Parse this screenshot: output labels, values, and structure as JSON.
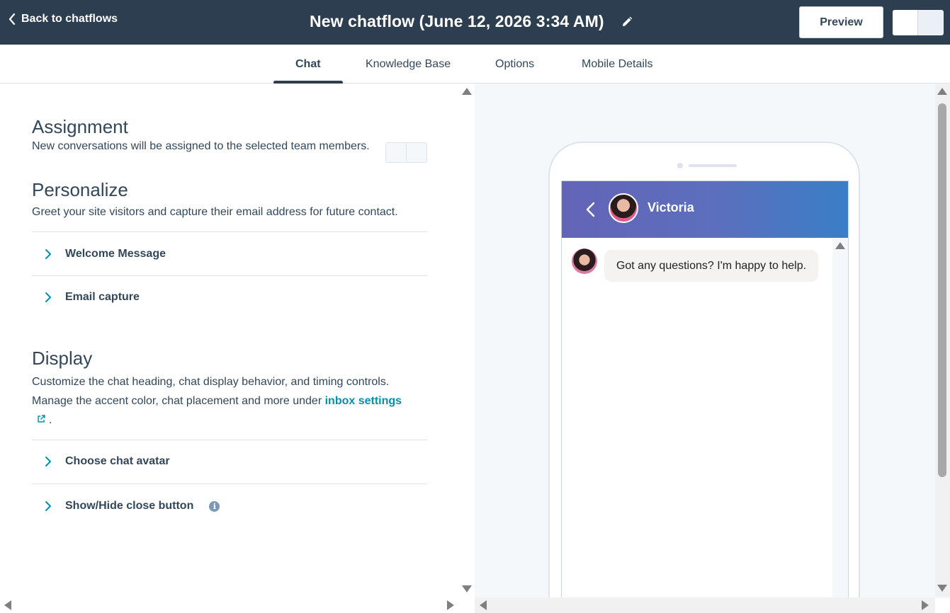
{
  "header": {
    "back_label": "Back to chatflows",
    "title": "New chatflow (June 12, 2026 3:34 AM)",
    "preview_label": "Preview"
  },
  "tabs": [
    {
      "label": "Chat",
      "active": true
    },
    {
      "label": "Knowledge Base",
      "active": false
    },
    {
      "label": "Options",
      "active": false
    },
    {
      "label": "Mobile Details",
      "active": false
    }
  ],
  "assignment": {
    "title": "Assignment",
    "description": "New conversations will be assigned to the selected team members."
  },
  "personalize": {
    "title": "Personalize",
    "description": "Greet your site visitors and capture their email address for future contact.",
    "items": [
      "Welcome Message",
      "Email capture"
    ]
  },
  "display": {
    "title": "Display",
    "description_1": "Customize the chat heading, chat display behavior, and timing controls.",
    "description_2": "Manage the accent color, chat placement and more under",
    "link_label": "inbox settings",
    "description_end": ".",
    "items": [
      "Choose chat avatar",
      "Show/Hide close button"
    ]
  },
  "preview": {
    "agent_name": "Victoria",
    "message": "Got any questions? I'm happy to help."
  },
  "icons": {
    "back": "chevron-left-icon",
    "edit": "pencil-icon",
    "accordion": "chevron-right-icon",
    "external": "external-link-icon",
    "info": "info-icon"
  },
  "colors": {
    "header_bg": "#2d3e50",
    "link": "#0091ae",
    "chat_header_start": "#6464b7",
    "chat_header_end": "#3a7ec7"
  }
}
